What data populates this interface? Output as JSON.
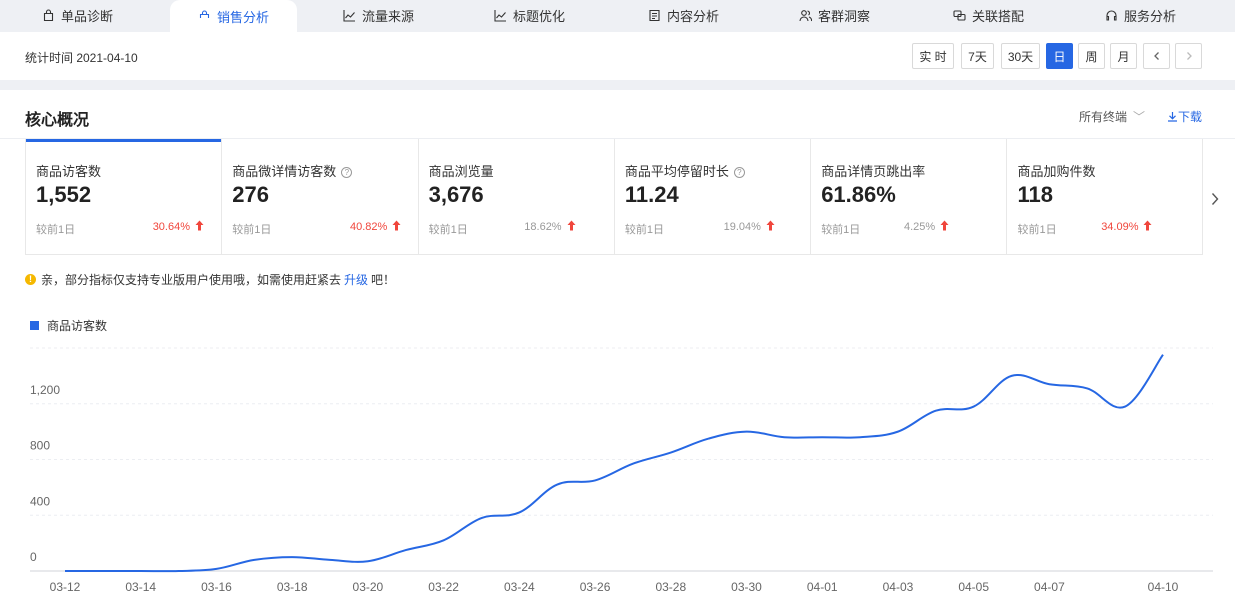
{
  "tabs": [
    {
      "label": "单品诊断",
      "icon": "bag-icon",
      "active": false
    },
    {
      "label": "销售分析",
      "icon": "bag-icon",
      "active": true
    },
    {
      "label": "流量来源",
      "icon": "trend-chart-icon",
      "active": false
    },
    {
      "label": "标题优化",
      "icon": "trend-chart-icon",
      "active": false
    },
    {
      "label": "内容分析",
      "icon": "document-icon",
      "active": false
    },
    {
      "label": "客群洞察",
      "icon": "users-icon",
      "active": false
    },
    {
      "label": "关联搭配",
      "icon": "link-chat-icon",
      "active": false
    },
    {
      "label": "服务分析",
      "icon": "headset-icon",
      "active": false
    }
  ],
  "stat_time": "统计时间 2021-04-10",
  "periods": {
    "realtime": "实 时",
    "d7": "7天",
    "d30": "30天",
    "day": "日",
    "week": "周",
    "month": "月",
    "selected": "日"
  },
  "core": {
    "title": "核心概况",
    "terminal": "所有终端",
    "download": "下载"
  },
  "metrics": [
    {
      "label": "商品访客数",
      "value": "1,552",
      "compare": "较前1日",
      "pct": "30.64%",
      "pct_style": "red",
      "has_help": false
    },
    {
      "label": "商品微详情访客数",
      "value": "276",
      "compare": "较前1日",
      "pct": "40.82%",
      "pct_style": "red",
      "has_help": true
    },
    {
      "label": "商品浏览量",
      "value": "3,676",
      "compare": "较前1日",
      "pct": "18.62%",
      "pct_style": "gray",
      "has_help": false
    },
    {
      "label": "商品平均停留时长",
      "value": "11.24",
      "compare": "较前1日",
      "pct": "19.04%",
      "pct_style": "gray",
      "has_help": true
    },
    {
      "label": "商品详情页跳出率",
      "value": "61.86%",
      "compare": "较前1日",
      "pct": "4.25%",
      "pct_style": "gray",
      "has_help": false
    },
    {
      "label": "商品加购件数",
      "value": "118",
      "compare": "较前1日",
      "pct": "34.09%",
      "pct_style": "red",
      "has_help": false
    }
  ],
  "notice": {
    "before": "亲，部分指标仅支持专业版用户使用哦，如需使用赶紧去",
    "link": "升级",
    "after": "吧！"
  },
  "colors": {
    "accent": "#2667e3",
    "up": "#f0463c"
  },
  "chart_data": {
    "type": "line",
    "title": "",
    "xlabel": "",
    "ylabel": "",
    "legend": "top-left",
    "grid": true,
    "ylim": [
      0,
      1600
    ],
    "yticks": [
      "0",
      "400",
      "800",
      "1,200",
      "1,600"
    ],
    "x": [
      "03-12",
      "03-13",
      "03-14",
      "03-15",
      "03-16",
      "03-17",
      "03-18",
      "03-19",
      "03-20",
      "03-21",
      "03-22",
      "03-23",
      "03-24",
      "03-25",
      "03-26",
      "03-27",
      "03-28",
      "03-29",
      "03-30",
      "03-31",
      "04-01",
      "04-02",
      "04-03",
      "04-04",
      "04-05",
      "04-06",
      "04-07",
      "04-08",
      "04-09",
      "04-10"
    ],
    "xtick_labels": [
      "03-12",
      "03-14",
      "03-16",
      "03-18",
      "03-20",
      "03-22",
      "03-24",
      "03-26",
      "03-28",
      "03-30",
      "04-01",
      "04-03",
      "04-05",
      "04-07",
      "04-10"
    ],
    "series": [
      {
        "name": "商品访客数",
        "color": "#2667e3",
        "values": [
          0,
          0,
          0,
          0,
          15,
          80,
          100,
          80,
          70,
          150,
          220,
          380,
          420,
          620,
          650,
          770,
          850,
          950,
          1000,
          960,
          960,
          960,
          1000,
          1150,
          1180,
          1400,
          1340,
          1310,
          1180,
          1552
        ]
      }
    ]
  }
}
